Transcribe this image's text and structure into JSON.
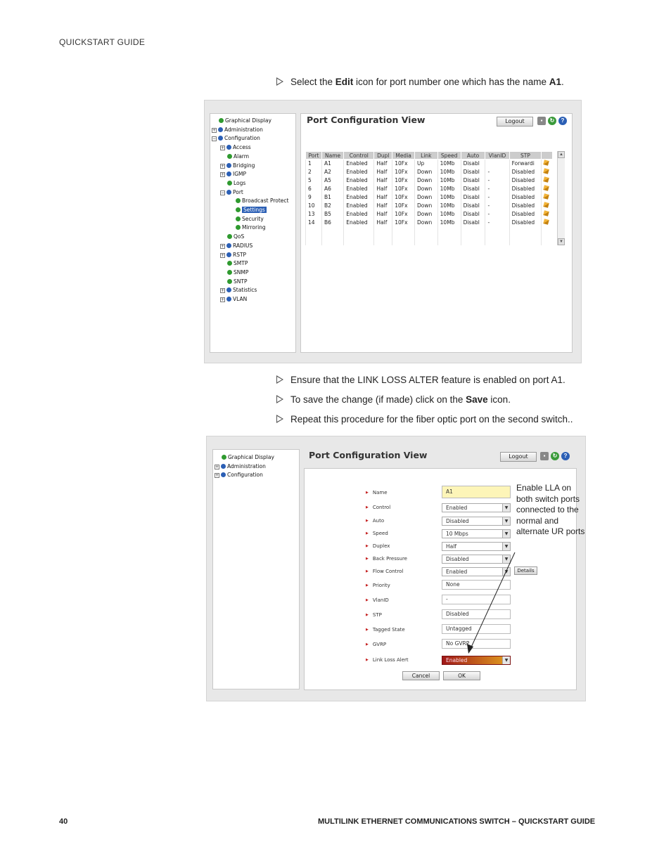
{
  "header": {
    "title": "QUICKSTART GUIDE"
  },
  "steps": {
    "s1": {
      "pre": "Select the ",
      "b1": "Edit",
      "mid": " icon for port number one which has the name ",
      "b2": "A1",
      "post": "."
    },
    "s2": {
      "text": "Ensure that the LINK LOSS ALTER feature is enabled on port A1."
    },
    "s3": {
      "pre": "To save the change (if made) click on the ",
      "b1": "Save",
      "post": " icon."
    },
    "s4": {
      "text": "Repeat this procedure for the fiber optic port on the second switch.."
    }
  },
  "screen1": {
    "title": "Port Configuration View",
    "logout": "Logout",
    "icons": [
      "save-icon",
      "refresh-icon",
      "help-icon"
    ],
    "tree": [
      "Graphical Display",
      "Administration",
      "Configuration",
      "Access",
      "Alarm",
      "Bridging",
      "IGMP",
      "Logs",
      "Port",
      "Broadcast Protect",
      "Settings",
      "Security",
      "Mirroring",
      "QoS",
      "RADIUS",
      "RSTP",
      "SMTP",
      "SNMP",
      "SNTP",
      "Statistics",
      "VLAN"
    ],
    "columns": [
      "Port",
      "Name",
      "Control",
      "Dupl",
      "Media",
      "Link",
      "Speed",
      "Auto",
      "VlanID",
      "STP"
    ],
    "rows": [
      [
        "1",
        "A1",
        "Enabled",
        "Half",
        "10Fx",
        "Up",
        "10Mb",
        "Disabl",
        "",
        "Forwardi"
      ],
      [
        "2",
        "A2",
        "Enabled",
        "Half",
        "10Fx",
        "Down",
        "10Mb",
        "Disabl",
        "-",
        "Disabled"
      ],
      [
        "5",
        "A5",
        "Enabled",
        "Half",
        "10Fx",
        "Down",
        "10Mb",
        "Disabl",
        "-",
        "Disabled"
      ],
      [
        "6",
        "A6",
        "Enabled",
        "Half",
        "10Fx",
        "Down",
        "10Mb",
        "Disabl",
        "-",
        "Disabled"
      ],
      [
        "9",
        "B1",
        "Enabled",
        "Half",
        "10Fx",
        "Down",
        "10Mb",
        "Disabl",
        "-",
        "Disabled"
      ],
      [
        "10",
        "B2",
        "Enabled",
        "Half",
        "10Fx",
        "Down",
        "10Mb",
        "Disabl",
        "-",
        "Disabled"
      ],
      [
        "13",
        "B5",
        "Enabled",
        "Half",
        "10Fx",
        "Down",
        "10Mb",
        "Disabl",
        "-",
        "Disabled"
      ],
      [
        "14",
        "B6",
        "Enabled",
        "Half",
        "10Fx",
        "Down",
        "10Mb",
        "Disabl",
        "-",
        "Disabled"
      ]
    ]
  },
  "screen2": {
    "title": "Port Configuration View",
    "logout": "Logout",
    "tree": [
      "Graphical Display",
      "Administration",
      "Configuration"
    ],
    "fields": {
      "name": {
        "label": "Name",
        "value": "A1"
      },
      "control": {
        "label": "Control",
        "value": "Enabled"
      },
      "auto": {
        "label": "Auto",
        "value": "Disabled"
      },
      "speed": {
        "label": "Speed",
        "value": "10 Mbps"
      },
      "duplex": {
        "label": "Duplex",
        "value": "Half"
      },
      "back_pressure": {
        "label": "Back Pressure",
        "value": "Disabled"
      },
      "flow_control": {
        "label": "Flow Control",
        "value": "Enabled",
        "details": "Details"
      },
      "priority": {
        "label": "Priority",
        "value": "None"
      },
      "vlanid": {
        "label": "VlanID",
        "value": "-"
      },
      "stp": {
        "label": "STP",
        "value": "Disabled"
      },
      "tagged_state": {
        "label": "Tagged State",
        "value": "Untagged"
      },
      "gvrp": {
        "label": "GVRP",
        "value": "No GVRP"
      },
      "link_loss_alert": {
        "label": "Link Loss Alert",
        "value": "Enabled"
      }
    },
    "cancel": "Cancel",
    "ok": "OK",
    "annotation": "Enable LLA on both switch ports connected to the normal and alternate UR ports"
  },
  "footer": {
    "page": "40",
    "title": "MULTILINK ETHERNET COMMUNICATIONS SWITCH – QUICKSTART GUIDE"
  }
}
